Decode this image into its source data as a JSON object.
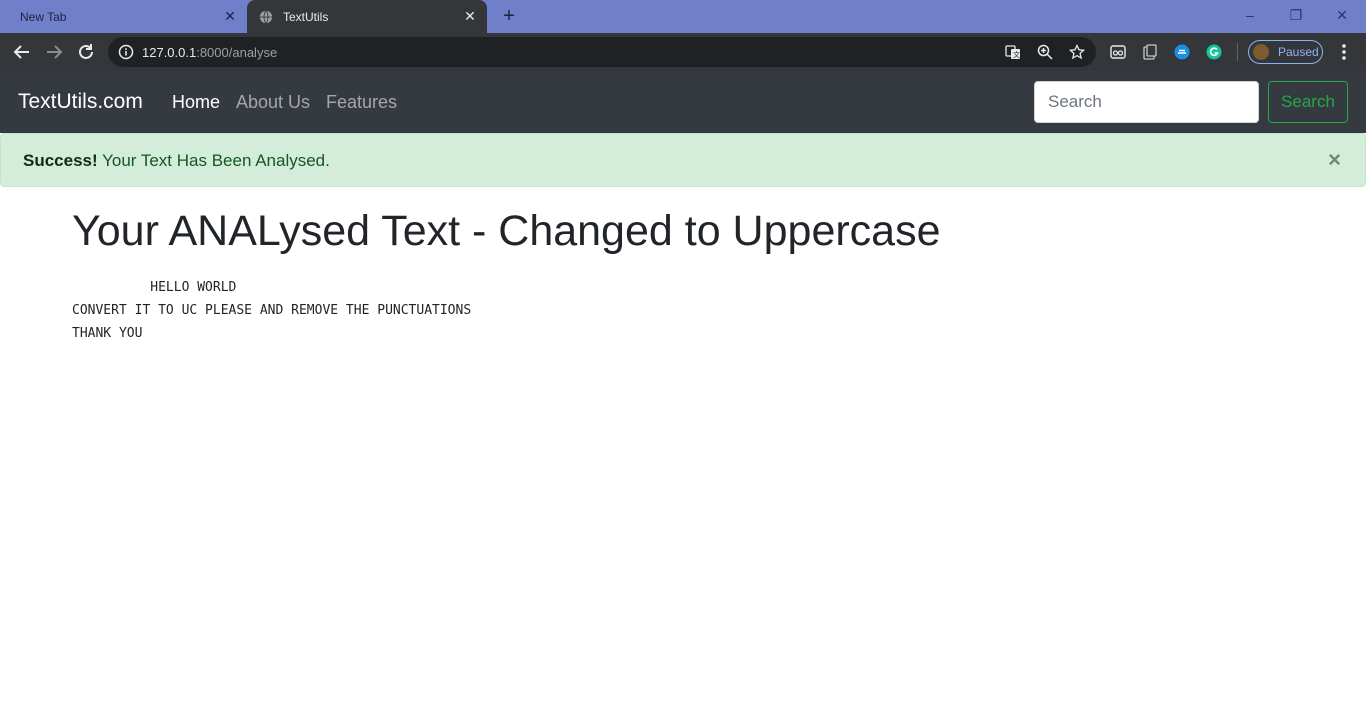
{
  "browser": {
    "tabs": [
      {
        "title": "New Tab",
        "active": false
      },
      {
        "title": "TextUtils",
        "active": true
      }
    ],
    "url_host": "127.0.0.1",
    "url_rest": ":8000/analyse",
    "profile_status": "Paused"
  },
  "navbar": {
    "brand": "TextUtils.com",
    "links": [
      "Home",
      "About Us",
      "Features"
    ],
    "search_placeholder": "Search",
    "search_button": "Search"
  },
  "alert": {
    "strong": "Success!",
    "message": " Your Text Has Been Analysed.",
    "close": "×"
  },
  "content": {
    "heading": "Your ANALysed Text - Changed to Uppercase",
    "analysed_text": "          HELLO WORLD\nCONVERT IT TO UC PLEASE AND REMOVE THE PUNCTUATIONS\nTHANK YOU"
  },
  "colors": {
    "navbar_bg": "#343a40",
    "alert_bg": "#d4edda",
    "success": "#28a745",
    "tabstrip": "#6f7fc9"
  }
}
